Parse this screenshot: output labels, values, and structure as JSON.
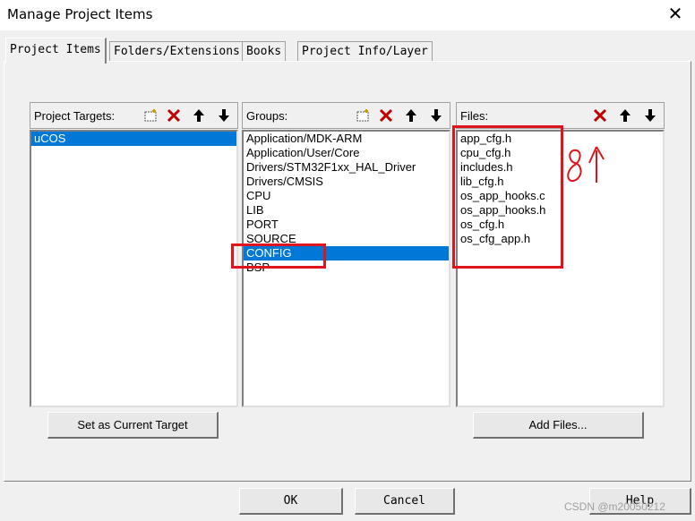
{
  "window": {
    "title": "Manage Project Items",
    "close_glyph": "✕"
  },
  "tabs": [
    {
      "label": "Project Items",
      "active": true
    },
    {
      "label": "Folders/Extensions",
      "active": false
    },
    {
      "label": "Books",
      "active": false
    },
    {
      "label": "Project Info/Layer",
      "active": false
    }
  ],
  "targets": {
    "title": "Project Targets:",
    "items": [
      "uCOS"
    ],
    "selected_index": 0,
    "button_label": "Set as Current Target"
  },
  "groups": {
    "title": "Groups:",
    "items": [
      "Application/MDK-ARM",
      "Application/User/Core",
      "Drivers/STM32F1xx_HAL_Driver",
      "Drivers/CMSIS",
      "CPU",
      "LIB",
      "PORT",
      "SOURCE",
      "CONFIG",
      "BSP"
    ],
    "selected_index": 8
  },
  "files": {
    "title": "Files:",
    "items": [
      "app_cfg.h",
      "cpu_cfg.h",
      "includes.h",
      "lib_cfg.h",
      "os_app_hooks.c",
      "os_app_hooks.h",
      "os_cfg.h",
      "os_cfg_app.h"
    ],
    "button_label": "Add Files..."
  },
  "footer": {
    "ok": "OK",
    "cancel": "Cancel",
    "help": "Help"
  },
  "watermark": "CSDN @m20050212",
  "annotation": {
    "handwritten_text": "8个",
    "color": "#e0141c"
  },
  "icons": {
    "new": "new-item-icon",
    "delete": "delete-icon",
    "up": "move-up-icon",
    "down": "move-down-icon"
  }
}
